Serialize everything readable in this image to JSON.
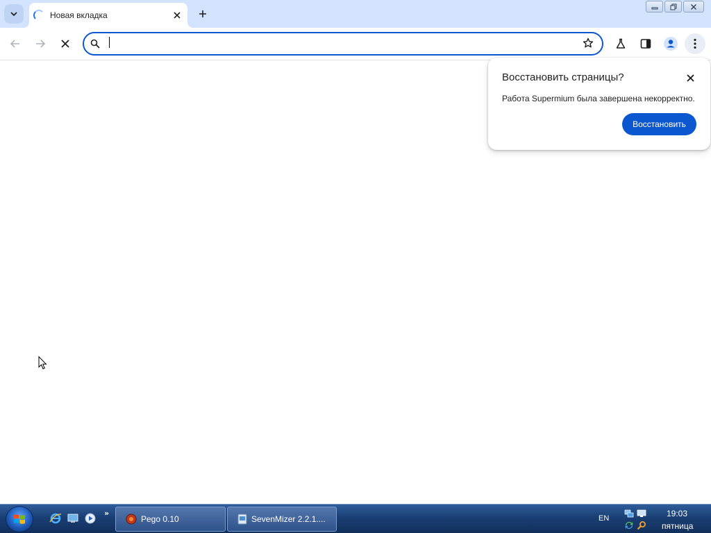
{
  "browser": {
    "tab": {
      "title": "Новая вкладка"
    },
    "omnibox": {
      "value": "",
      "placeholder": ""
    }
  },
  "popup": {
    "title": "Восстановить страницы?",
    "message": "Работа Supermium была завершена некорректно.",
    "button": "Восстановить"
  },
  "taskbar": {
    "tasks": [
      {
        "label": "Pego 0.10"
      },
      {
        "label": "SevenMizer 2.2.1...."
      }
    ],
    "language": "EN",
    "clock": {
      "time": "19:03",
      "day": "пятница"
    }
  },
  "colors": {
    "accent": "#0b57d0",
    "tabstrip": "#d3e3fd",
    "taskbar": "#1a3f74"
  }
}
